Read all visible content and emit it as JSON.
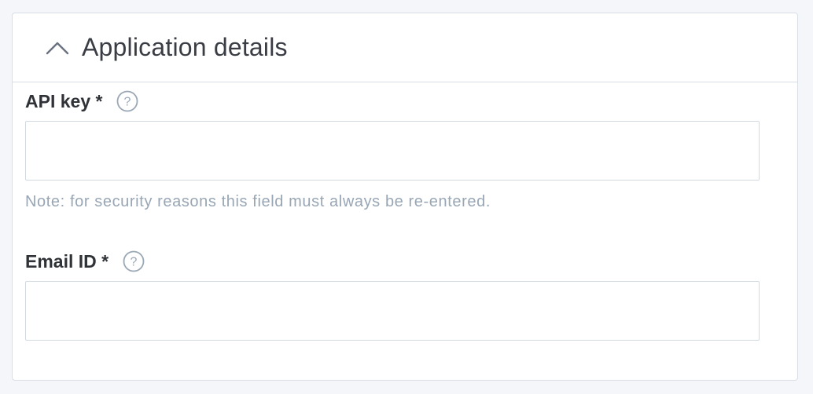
{
  "panel": {
    "title": "Application details",
    "expanded": true,
    "toggle_icon": "chevron-up-icon"
  },
  "fields": {
    "api_key": {
      "label": "API key *",
      "value": "",
      "help_icon": "question-circle-icon",
      "note": "Note: for security reasons this field must always be re-entered."
    },
    "email_id": {
      "label": "Email ID *",
      "value": "",
      "help_icon": "question-circle-icon"
    }
  },
  "colors": {
    "border": "#d8dde6",
    "note_text": "#98a6b5",
    "label_text": "#2f3237",
    "icon": "#9aa7b5"
  }
}
